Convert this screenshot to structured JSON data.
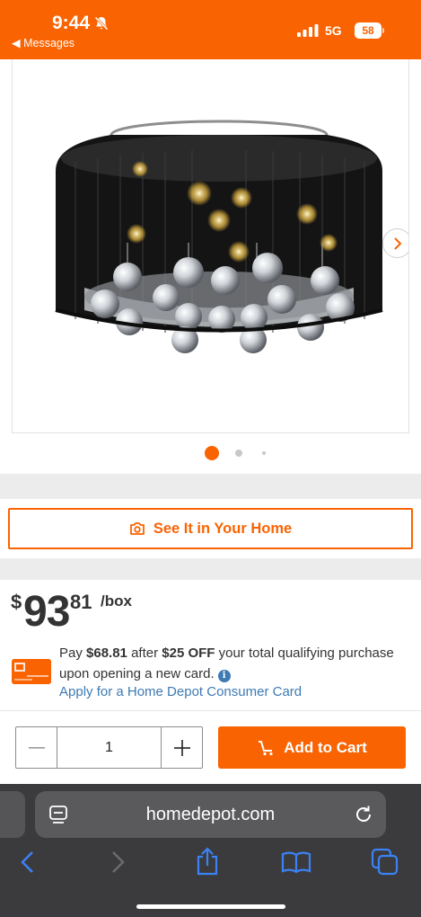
{
  "status_bar": {
    "time": "9:44",
    "back_label": "◀ Messages",
    "network": "5G",
    "battery": "58"
  },
  "product": {
    "image_icon": "crystal-chandelier-image",
    "next_icon": "chevron-right-icon"
  },
  "carousel": {
    "dot_count": 3,
    "active_index": 0
  },
  "see_it": {
    "label": "See It in Your Home",
    "icon": "camera-icon"
  },
  "price": {
    "dollar_sign": "$",
    "dollars": "93",
    "cents": "81",
    "unit": "/box"
  },
  "promo": {
    "text_pay": "Pay ",
    "promo_price": "$68.81",
    "text_after": " after ",
    "discount": "$25 OFF",
    "text_rest": " your total qualifying purchase upon opening a new card.",
    "info_icon": "i",
    "apply_link": "Apply for a Home Depot Consumer Card",
    "card_icon": "credit-card-icon"
  },
  "cart": {
    "quantity": "1",
    "add_label": "Add to Cart",
    "minus_icon": "minus-icon",
    "plus_icon": "plus-icon",
    "cart_icon": "cart-icon"
  },
  "browser": {
    "url": "homedepot.com",
    "toolbar_icons": [
      "back-icon",
      "forward-icon",
      "share-icon",
      "bookmarks-icon",
      "tabs-icon"
    ]
  },
  "colors": {
    "brand_orange": "#f96302",
    "link_blue": "#3e7ab3",
    "browser_dark": "#3b3b3d"
  }
}
